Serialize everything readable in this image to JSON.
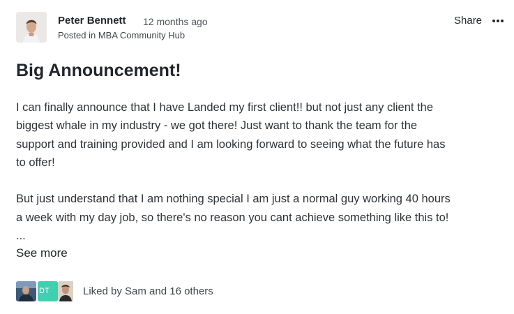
{
  "post": {
    "author": "Peter Bennett",
    "timestamp": "12 months ago",
    "posted_in": "Posted in MBA Community Hub",
    "share_label": "Share",
    "title": "Big Announcement!",
    "body_lines_p1": [
      "I can finally announce that I have Landed my first client!! but not just any client the",
      "biggest whale in my industry - we got there! Just want to thank the team for the",
      "support and training provided and I am looking forward to seeing what the future has",
      "to offer!"
    ],
    "body_lines_p2": [
      "But just understand that I am nothing special I am just a normal guy working 40 hours",
      "a week with my day job, so there's no reason you cant achieve something like this to!",
      "..."
    ],
    "see_more_label": "See more",
    "likers": [
      {
        "icon": "avatar-photo"
      },
      {
        "initials": "DT",
        "color": "#3fd0b0"
      },
      {
        "icon": "avatar-photo"
      }
    ],
    "liked_text": "Liked by Sam and 16 others"
  }
}
